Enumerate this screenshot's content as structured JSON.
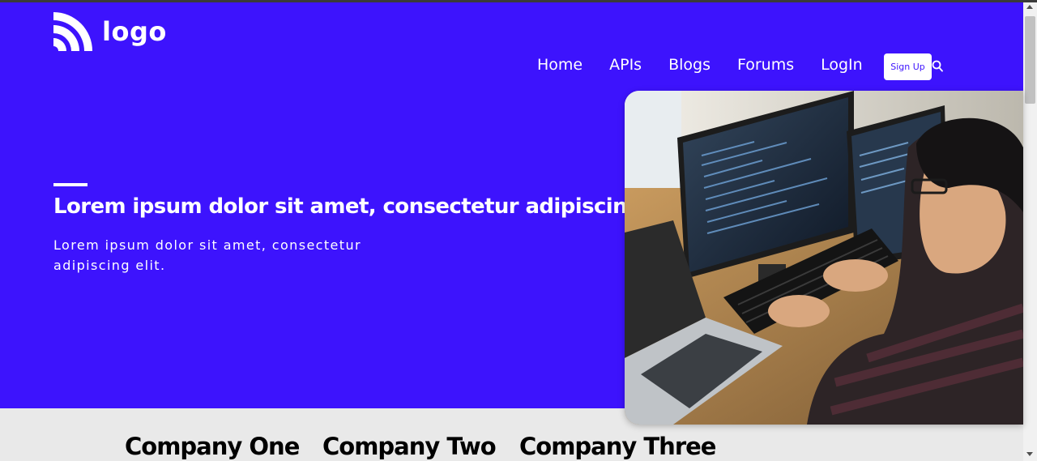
{
  "brand": {
    "logo_text": "logo",
    "logo_icon": "rss-wifi-icon"
  },
  "nav": {
    "items": [
      "Home",
      "APIs",
      "Blogs",
      "Forums",
      "LogIn"
    ],
    "signup_label": "Sign Up",
    "search_icon": "search-icon"
  },
  "hero": {
    "title": "Lorem ipsum dolor sit amet, consectetur adipiscing",
    "subtitle": "Lorem ipsum dolor sit amet, consectetur adipiscing elit.",
    "image": "developer-at-computers-photo"
  },
  "companies": [
    "Company One",
    "Company Two",
    "Company Three"
  ],
  "colors": {
    "hero_bg": "#3d13fd",
    "text_light": "#ffffff",
    "strip_bg": "#e9e9e9"
  }
}
